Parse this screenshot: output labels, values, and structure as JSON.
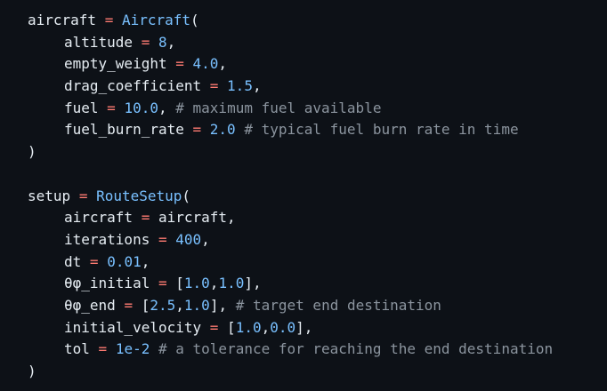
{
  "code": {
    "aircraft_block": {
      "var": "aircraft",
      "assign": "=",
      "call": "Aircraft",
      "open": "(",
      "close": ")",
      "args": [
        {
          "name": "altitude",
          "eq": "=",
          "value": "8",
          "trail": ","
        },
        {
          "name": "empty_weight",
          "eq": "=",
          "value": "4.0",
          "trail": ","
        },
        {
          "name": "drag_coefficient",
          "eq": "=",
          "value": "1.5",
          "trail": ","
        },
        {
          "name": "fuel",
          "eq": "=",
          "value": "10.0",
          "trail": ",",
          "comment": "# maximum fuel available"
        },
        {
          "name": "fuel_burn_rate",
          "eq": "=",
          "value": "2.0",
          "trail": "",
          "comment": "# typical fuel burn rate in time"
        }
      ]
    },
    "setup_block": {
      "var": "setup",
      "assign": "=",
      "call": "RouteSetup",
      "open": "(",
      "close": ")",
      "args": [
        {
          "name": "aircraft",
          "eq": "=",
          "value_plain": "aircraft",
          "trail": ","
        },
        {
          "name": "iterations",
          "eq": "=",
          "value": "400",
          "trail": ","
        },
        {
          "name": "dt",
          "eq": "=",
          "value": "0.01",
          "trail": ","
        },
        {
          "name": "θφ_initial",
          "eq": "=",
          "lb": "[",
          "v1": "1.0",
          "comma": ",",
          "v2": "1.0",
          "rb": "]",
          "trail": ","
        },
        {
          "name": "θφ_end",
          "eq": "=",
          "lb": "[",
          "v1": "2.5",
          "comma": ",",
          "v2": "1.0",
          "rb": "]",
          "trail": ",",
          "comment": "# target end destination"
        },
        {
          "name": "initial_velocity",
          "eq": "=",
          "lb": "[",
          "v1": "1.0",
          "comma": ",",
          "v2": "0.0",
          "rb": "]",
          "trail": ","
        },
        {
          "name": "tol",
          "eq": "=",
          "value": "1e-2",
          "trail": "",
          "comment": "# a tolerance for reaching the end destination"
        }
      ]
    }
  },
  "colors": {
    "background": "#0d1117",
    "text": "#e6edf3",
    "operator": "#ff7b72",
    "function": "#79c0ff",
    "number": "#79c0ff",
    "comment": "#8b949e"
  }
}
